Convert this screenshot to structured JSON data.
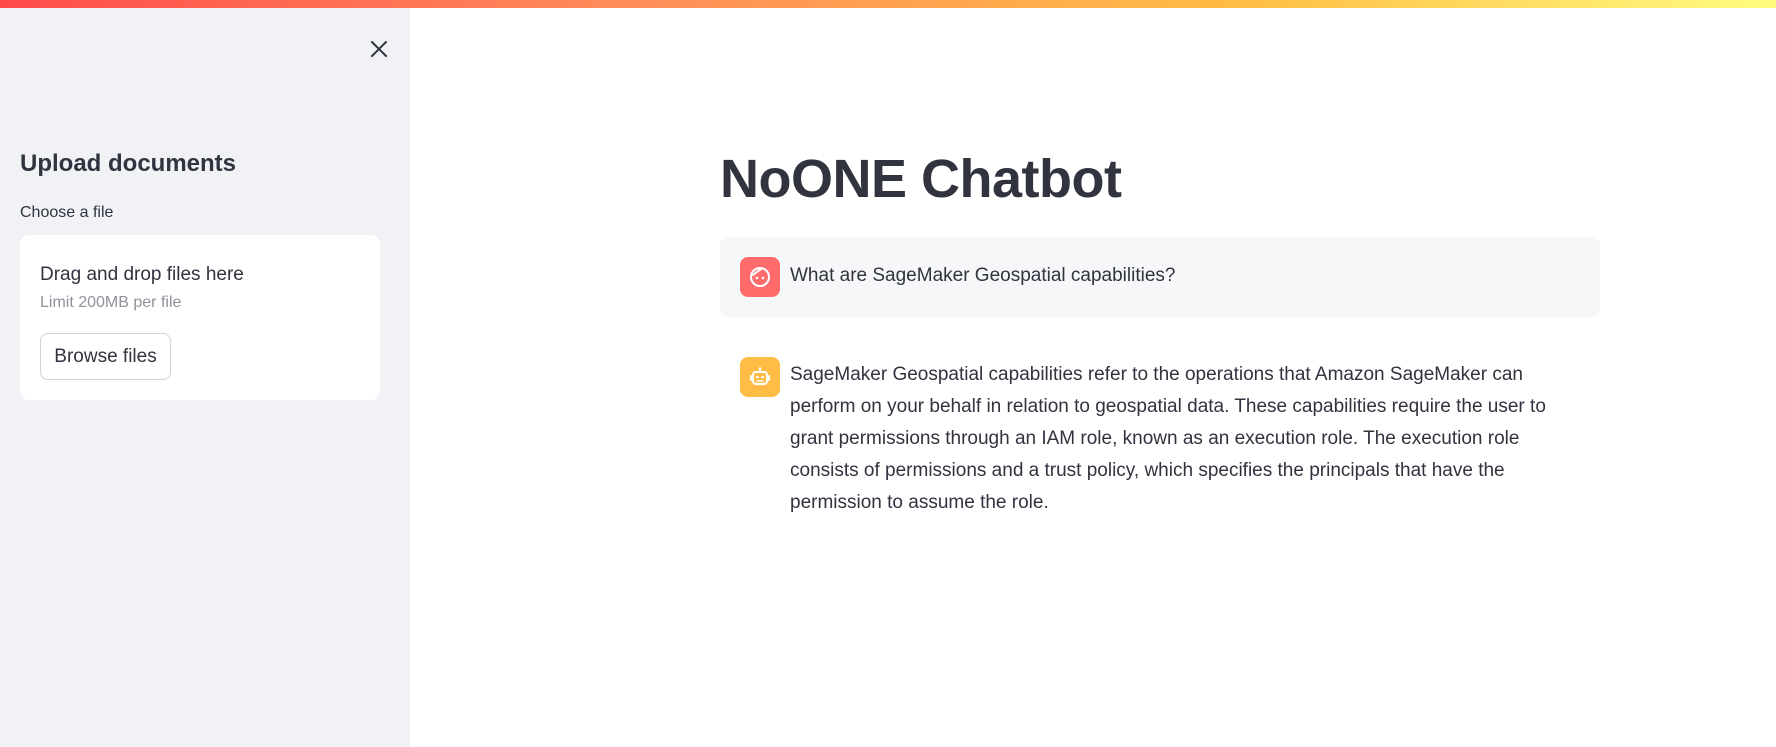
{
  "sidebar": {
    "title": "Upload documents",
    "file_label": "Choose a file",
    "dropzone": {
      "title": "Drag and drop files here",
      "limit": "Limit 200MB per file",
      "browse_label": "Browse files"
    }
  },
  "main": {
    "title": "NoONE Chatbot",
    "messages": [
      {
        "role": "user",
        "text": "What are SageMaker Geospatial capabilities?"
      },
      {
        "role": "assistant",
        "text": "SageMaker Geospatial capabilities refer to the operations that Amazon SageMaker can perform on your behalf in relation to geospatial data. These capabilities require the user to grant permissions through an IAM role, known as an execution role. The execution role consists of permissions and a trust policy, which specifies the principals that have the permission to assume the role."
      }
    ]
  },
  "colors": {
    "user_avatar": "#ff6b6b",
    "bot_avatar": "#ffbd45",
    "sidebar_bg": "#f0f2f6"
  },
  "icons": {
    "close": "close-icon",
    "user_avatar": "user-face-icon",
    "bot_avatar": "robot-icon"
  }
}
